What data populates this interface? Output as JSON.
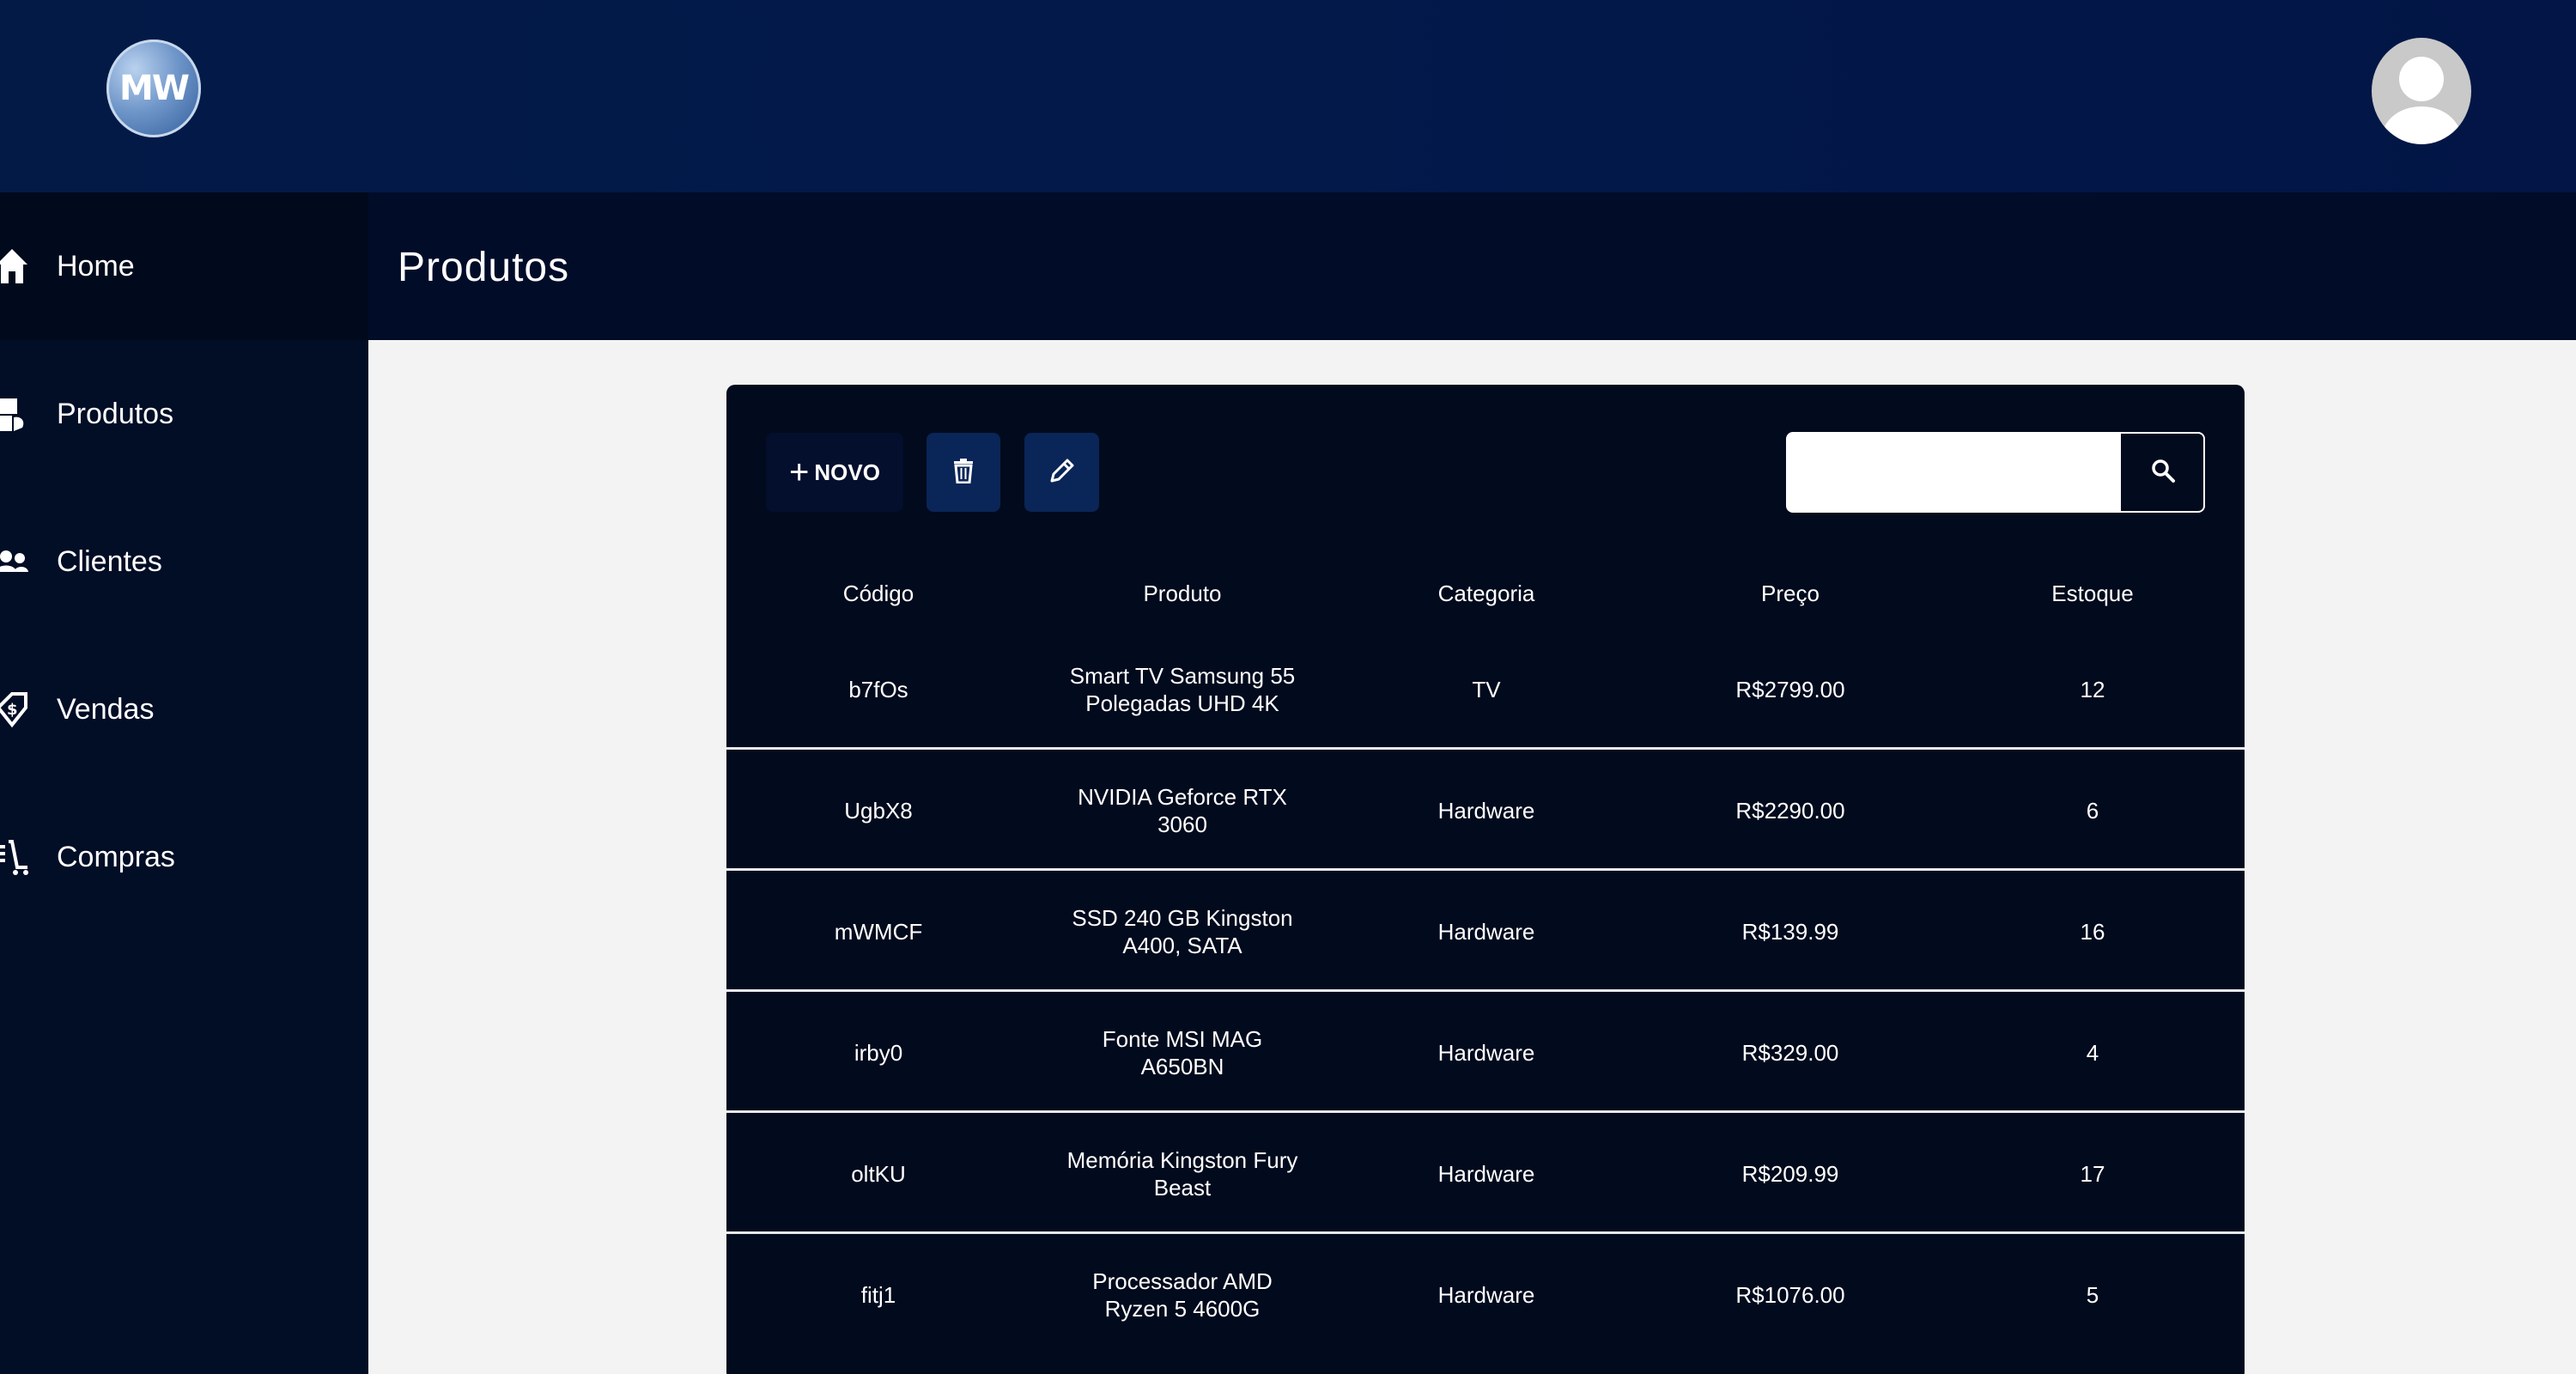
{
  "header": {
    "logo_text": "MW",
    "avatar": "user-avatar"
  },
  "sidebar": {
    "items": [
      {
        "label": "Home",
        "icon": "home-icon"
      },
      {
        "label": "Produtos",
        "icon": "boxes-icon"
      },
      {
        "label": "Clientes",
        "icon": "users-icon"
      },
      {
        "label": "Vendas",
        "icon": "sales-tag-icon"
      },
      {
        "label": "Compras",
        "icon": "cart-icon"
      }
    ]
  },
  "page": {
    "title": "Produtos"
  },
  "toolbar": {
    "new_label": "NOVO",
    "delete_icon": "trash-icon",
    "edit_icon": "pencil-icon",
    "search_placeholder": "",
    "search_value": ""
  },
  "table": {
    "columns": [
      "Código",
      "Produto",
      "Categoria",
      "Preço",
      "Estoque"
    ],
    "rows": [
      [
        "b7fOs",
        "Smart TV Samsung 55 Polegadas UHD 4K",
        "TV",
        "R$2799.00",
        "12"
      ],
      [
        "UgbX8",
        "NVIDIA Geforce RTX 3060",
        "Hardware",
        "R$2290.00",
        "6"
      ],
      [
        "mWMCF",
        "SSD 240 GB Kingston A400, SATA",
        "Hardware",
        "R$139.99",
        "16"
      ],
      [
        "irby0",
        "Fonte MSI MAG A650BN",
        "Hardware",
        "R$329.00",
        "4"
      ],
      [
        "oltKU",
        "Memória Kingston Fury Beast",
        "Hardware",
        "R$209.99",
        "17"
      ],
      [
        "fitj1",
        "Processador AMD Ryzen 5 4600G",
        "Hardware",
        "R$1076.00",
        "5"
      ]
    ]
  },
  "colors": {
    "header": "#031a47",
    "sidebar": "#020d26",
    "card": "#020a1d",
    "action_button": "#0a2557",
    "background": "#f3f3f3"
  }
}
